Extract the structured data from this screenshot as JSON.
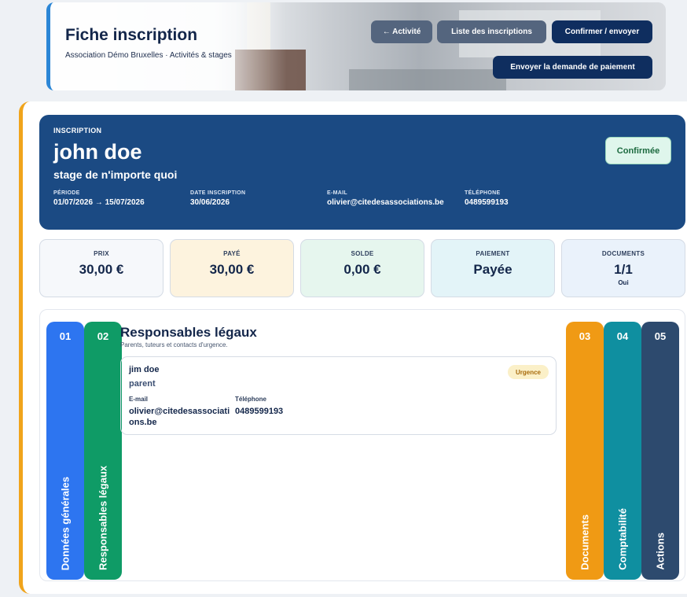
{
  "header": {
    "title": "Fiche inscription",
    "subtitle": "Association Démo Bruxelles · Activités & stages",
    "buttons": {
      "back": "← Activité",
      "list": "Liste des inscriptions",
      "confirm": "Confirmer / envoyer",
      "payment_request": "Envoyer la demande de paiement"
    }
  },
  "inscription": {
    "kicker": "INSCRIPTION",
    "name": "john doe",
    "activity": "stage de n'importe quoi",
    "status": "Confirmée",
    "meta": [
      {
        "label": "PÉRIODE",
        "value": "01/07/2026 → 15/07/2026"
      },
      {
        "label": "DATE INSCRIPTION",
        "value": "30/06/2026"
      },
      {
        "label": "E-MAIL",
        "value": "olivier@citedesassociations.be"
      },
      {
        "label": "TÉLÉPHONE",
        "value": "0489599193"
      }
    ]
  },
  "stats": [
    {
      "label": "PRIX",
      "value": "30,00 €",
      "sub": "",
      "bg": "#f6f8fb"
    },
    {
      "label": "PAYÉ",
      "value": "30,00 €",
      "sub": "",
      "bg": "#fdf3de"
    },
    {
      "label": "SOLDE",
      "value": "0,00 €",
      "sub": "",
      "bg": "#e6f6ee"
    },
    {
      "label": "PAIEMENT",
      "value": "Payée",
      "sub": "",
      "bg": "#e3f4f8"
    },
    {
      "label": "DOCUMENTS",
      "value": "1/1",
      "sub": "Oui",
      "bg": "#eaf2fb"
    }
  ],
  "tabs": [
    {
      "num": "01",
      "label": "Données générales",
      "color": "#2d75f0"
    },
    {
      "num": "02",
      "label": "Responsables légaux",
      "color": "#0f9b66"
    },
    {
      "num": "03",
      "label": "Documents",
      "color": "#f09a14"
    },
    {
      "num": "04",
      "label": "Comptabilité",
      "color": "#0f8fa0"
    },
    {
      "num": "05",
      "label": "Actions",
      "color": "#2d4a6e"
    }
  ],
  "section": {
    "title": "Responsables légaux",
    "subtitle": "Parents, tuteurs et contacts d'urgence.",
    "contact": {
      "name": "jim doe",
      "role": "parent",
      "badge": "Urgence",
      "email_label": "E-mail",
      "email": "olivier@citedesassociations.be",
      "phone_label": "Téléphone",
      "phone": "0489599193"
    }
  }
}
